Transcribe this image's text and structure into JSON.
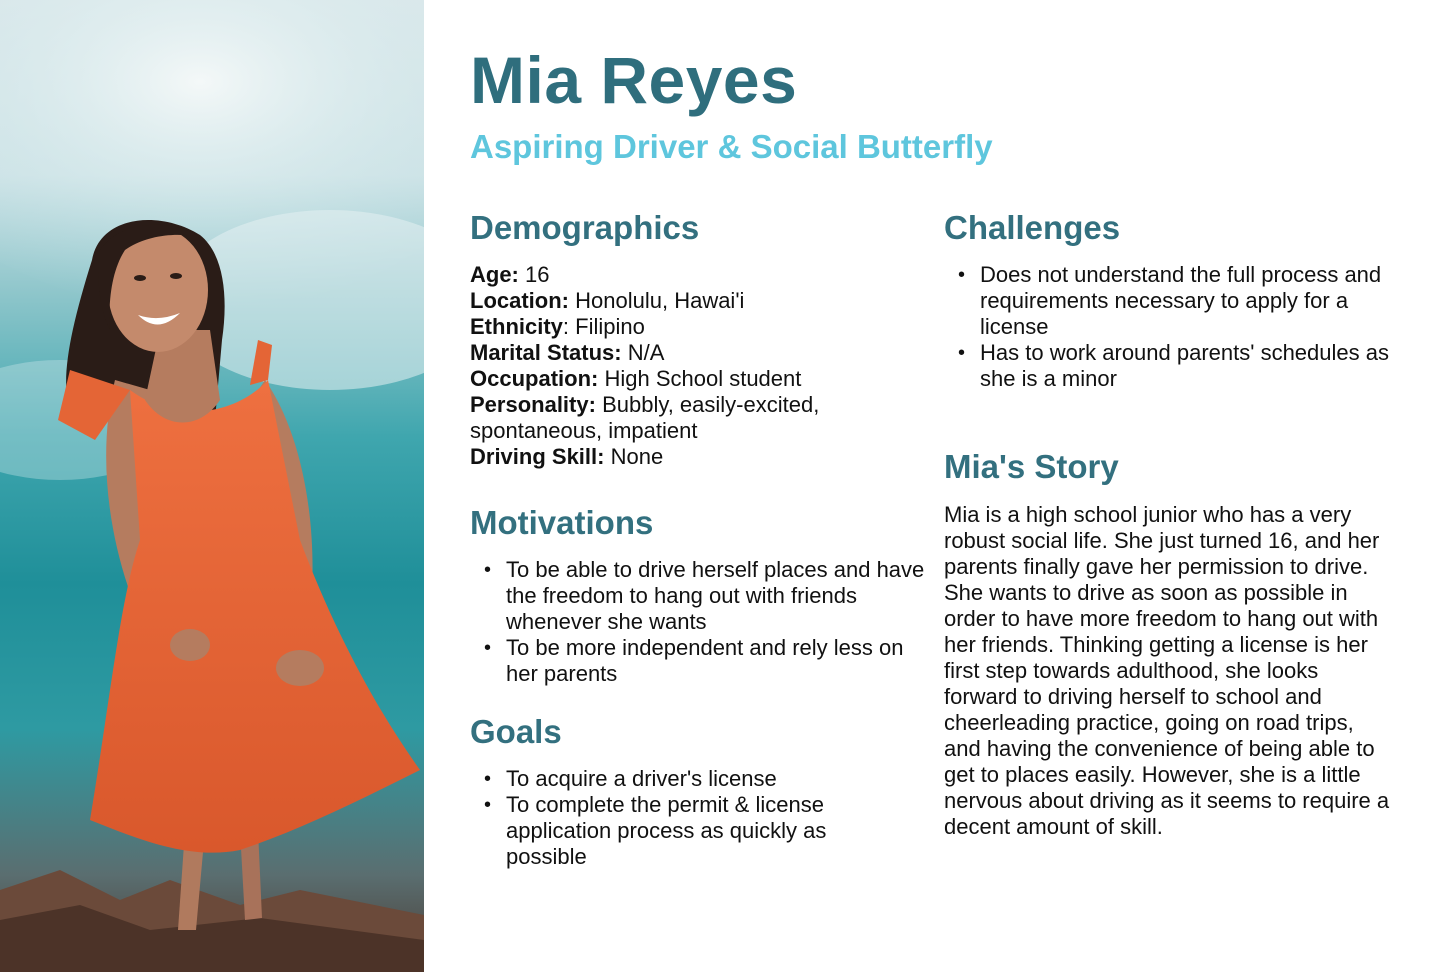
{
  "persona": {
    "name": "Mia Reyes",
    "tagline": "Aspiring Driver & Social Butterfly"
  },
  "demographics": {
    "title": "Demographics",
    "age_label": "Age:",
    "age": "16",
    "location_label": "Location:",
    "location": "Honolulu, Hawai'i",
    "ethnicity_label": "Ethnicity",
    "ethnicity": ": Filipino",
    "marital_label": "Marital Status:",
    "marital": "N/A",
    "occupation_label": "Occupation:",
    "occupation": "High School student",
    "personality_label": "Personality:",
    "personality": "Bubbly, easily-excited, spontaneous, impatient",
    "driving_label": "Driving Skill:",
    "driving": "None"
  },
  "motivations": {
    "title": "Motivations",
    "items": [
      "To be able to drive herself places and have the freedom to hang out with friends whenever she wants",
      "To be more independent and rely less on her parents"
    ]
  },
  "goals": {
    "title": "Goals",
    "items": [
      "To acquire a driver's license",
      "To complete the permit & license application process as quickly as possible"
    ]
  },
  "challenges": {
    "title": "Challenges",
    "items": [
      "Does not understand the full process and requirements necessary to apply for a license",
      "Has to work around parents' schedules as she is a minor"
    ]
  },
  "story": {
    "title": "Mia's Story",
    "text": "Mia is a high school junior who has a very robust social life. She just turned 16, and her parents finally gave her permission to drive. She wants to drive as soon as possible in order to have more freedom to hang out with her friends. Thinking getting a license is her first step towards adulthood, she looks forward to driving herself to school and cheerleading practice, going on road trips, and having the convenience of being able to get to places easily. However, she is a little nervous about driving as it seems to require a decent amount of skill."
  },
  "colors": {
    "name": "#2f6e7d",
    "tagline": "#5ec6dd",
    "headings": "#33707f",
    "dress": "#e8663a"
  }
}
